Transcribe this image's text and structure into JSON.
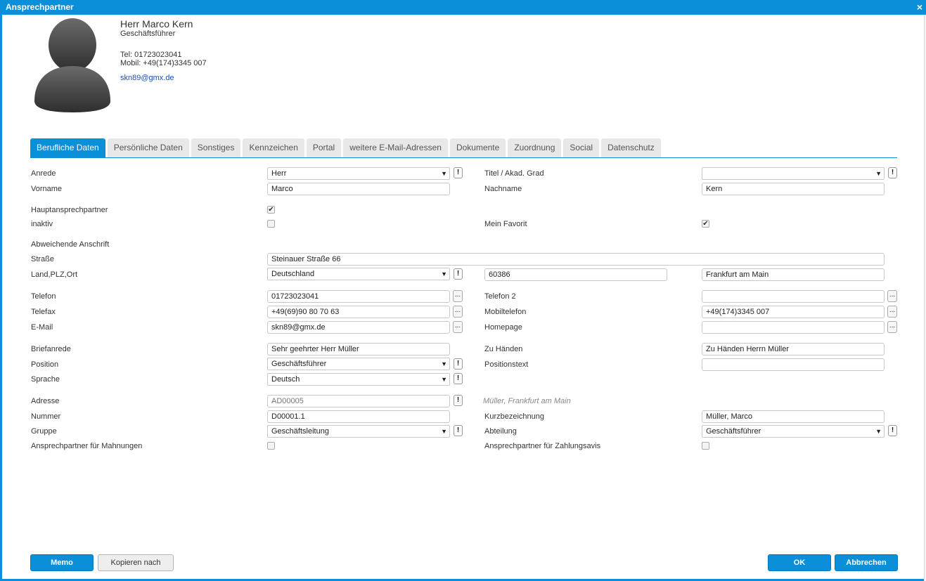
{
  "window": {
    "title": "Ansprechpartner",
    "close_glyph": "×"
  },
  "header": {
    "name": "Herr Marco Kern",
    "position": "Geschäftsführer",
    "tel": "Tel: 01723023041",
    "mobil": "Mobil: +49(174)3345 007",
    "email": "skn89@gmx.de",
    "avatar_icon": "person-silhouette-icon"
  },
  "tabs": [
    {
      "label": "Berufliche Daten",
      "active": true
    },
    {
      "label": "Persönliche Daten"
    },
    {
      "label": "Sonstiges"
    },
    {
      "label": "Kennzeichen"
    },
    {
      "label": "Portal"
    },
    {
      "label": "weitere E-Mail-Adressen"
    },
    {
      "label": "Dokumente"
    },
    {
      "label": "Zuordnung"
    },
    {
      "label": "Social"
    },
    {
      "label": "Datenschutz"
    }
  ],
  "form": {
    "anrede": {
      "label": "Anrede",
      "value": "Herr"
    },
    "titel": {
      "label": "Titel / Akad. Grad",
      "value": ""
    },
    "vorname": {
      "label": "Vorname",
      "value": "Marco"
    },
    "nachname": {
      "label": "Nachname",
      "value": "Kern"
    },
    "hauptansprechpartner": {
      "label": "Hauptansprechpartner",
      "checked": true
    },
    "inaktiv": {
      "label": "inaktiv",
      "checked": false
    },
    "mein_favorit": {
      "label": "Mein Favorit",
      "checked": true
    },
    "abweichende_anschrift": {
      "label": "Abweichende Anschrift"
    },
    "strasse": {
      "label": "Straße",
      "value": "Steinauer Straße 66"
    },
    "land_plz_ort": {
      "label": "Land,PLZ,Ort",
      "land": "Deutschland",
      "plz": "60386",
      "ort": "Frankfurt am Main"
    },
    "telefon": {
      "label": "Telefon",
      "value": "01723023041"
    },
    "telefon2": {
      "label": "Telefon 2",
      "value": ""
    },
    "telefax": {
      "label": "Telefax",
      "value": "+49(69)90 80 70 63"
    },
    "mobiltelefon": {
      "label": "Mobiltelefon",
      "value": "+49(174)3345 007"
    },
    "email": {
      "label": "E-Mail",
      "value": "skn89@gmx.de"
    },
    "homepage": {
      "label": "Homepage",
      "value": ""
    },
    "briefanrede": {
      "label": "Briefanrede",
      "value": "Sehr geehrter Herr Müller"
    },
    "zu_haenden": {
      "label": "Zu Händen",
      "value": "Zu Händen Herrn Müller"
    },
    "position": {
      "label": "Position",
      "value": "Geschäftsführer"
    },
    "positionstext": {
      "label": "Positionstext",
      "value": ""
    },
    "sprache": {
      "label": "Sprache",
      "value": "Deutsch"
    },
    "adresse": {
      "label": "Adresse",
      "value": "AD00005",
      "hint": "Müller, Frankfurt am Main"
    },
    "nummer": {
      "label": "Nummer",
      "value": "D00001.1"
    },
    "kurzbezeichnung": {
      "label": "Kurzbezeichnung",
      "value": "Müller, Marco"
    },
    "gruppe": {
      "label": "Gruppe",
      "value": "Geschäftsleitung"
    },
    "abteilung": {
      "label": "Abteilung",
      "value": "Geschäftsführer"
    },
    "ap_mahnungen": {
      "label": "Ansprechpartner für Mahnungen",
      "checked": false
    },
    "ap_zahlungsavis": {
      "label": "Ansprechpartner für Zahlungsavis",
      "checked": false
    }
  },
  "glyphs": {
    "dropdown": "▼",
    "exclaim": "!",
    "dots": "...",
    "check": "✔"
  },
  "buttons": {
    "memo": "Memo",
    "kopieren": "Kopieren nach",
    "ok": "OK",
    "abbrechen": "Abbrechen"
  },
  "colors": {
    "accent": "#0a8fd8",
    "link": "#1a4fb0"
  }
}
